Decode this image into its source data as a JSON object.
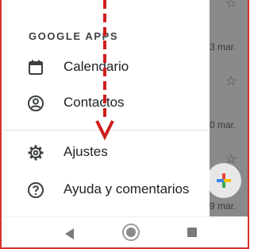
{
  "background": {
    "rows": [
      {
        "date": "3 mar."
      },
      {
        "date": "0 mar."
      },
      {
        "date": "9 mar."
      }
    ]
  },
  "drawer": {
    "section_label": "GOOGLE APPS",
    "items": [
      {
        "label": "Calendario",
        "icon": "calendar-icon"
      },
      {
        "label": "Contactos",
        "icon": "account-circle-icon"
      },
      {
        "label": "Ajustes",
        "icon": "gear-icon"
      },
      {
        "label": "Ayuda y comentarios",
        "icon": "help-circle-icon"
      }
    ]
  },
  "navbar": {
    "icons": [
      "back-icon",
      "home-icon",
      "recents-icon"
    ]
  },
  "annotation": {
    "swipe_color": "#d01e1e",
    "icon": "swipe-down-arrow-icon"
  }
}
